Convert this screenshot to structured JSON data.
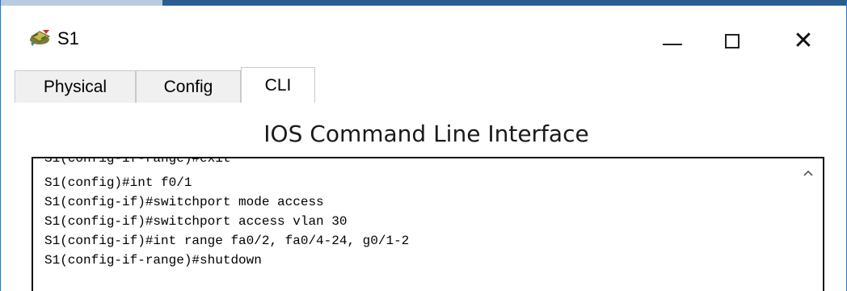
{
  "window": {
    "title": "S1"
  },
  "controls": {
    "minimize": "minimize",
    "maximize": "maximize",
    "close": "close"
  },
  "tabs": [
    {
      "label": "Physical",
      "active": false
    },
    {
      "label": "Config",
      "active": false
    },
    {
      "label": "CLI",
      "active": true
    }
  ],
  "cli": {
    "heading": "IOS Command Line Interface",
    "cut_line": "S1(config-if-range)#exit",
    "lines": [
      "S1(config)#int f0/1",
      "S1(config-if)#switchport mode access",
      "S1(config-if)#switchport access vlan 30",
      "S1(config-if)#int range fa0/2, fa0/4-24, g0/1-2",
      "S1(config-if-range)#shutdown"
    ]
  },
  "colors": {
    "frame_dark": "#2c5d92",
    "frame_light": "#b8cbe0"
  },
  "icons": {
    "app": "switch-icon",
    "scroll": "scroll-up-arrow-icon"
  }
}
